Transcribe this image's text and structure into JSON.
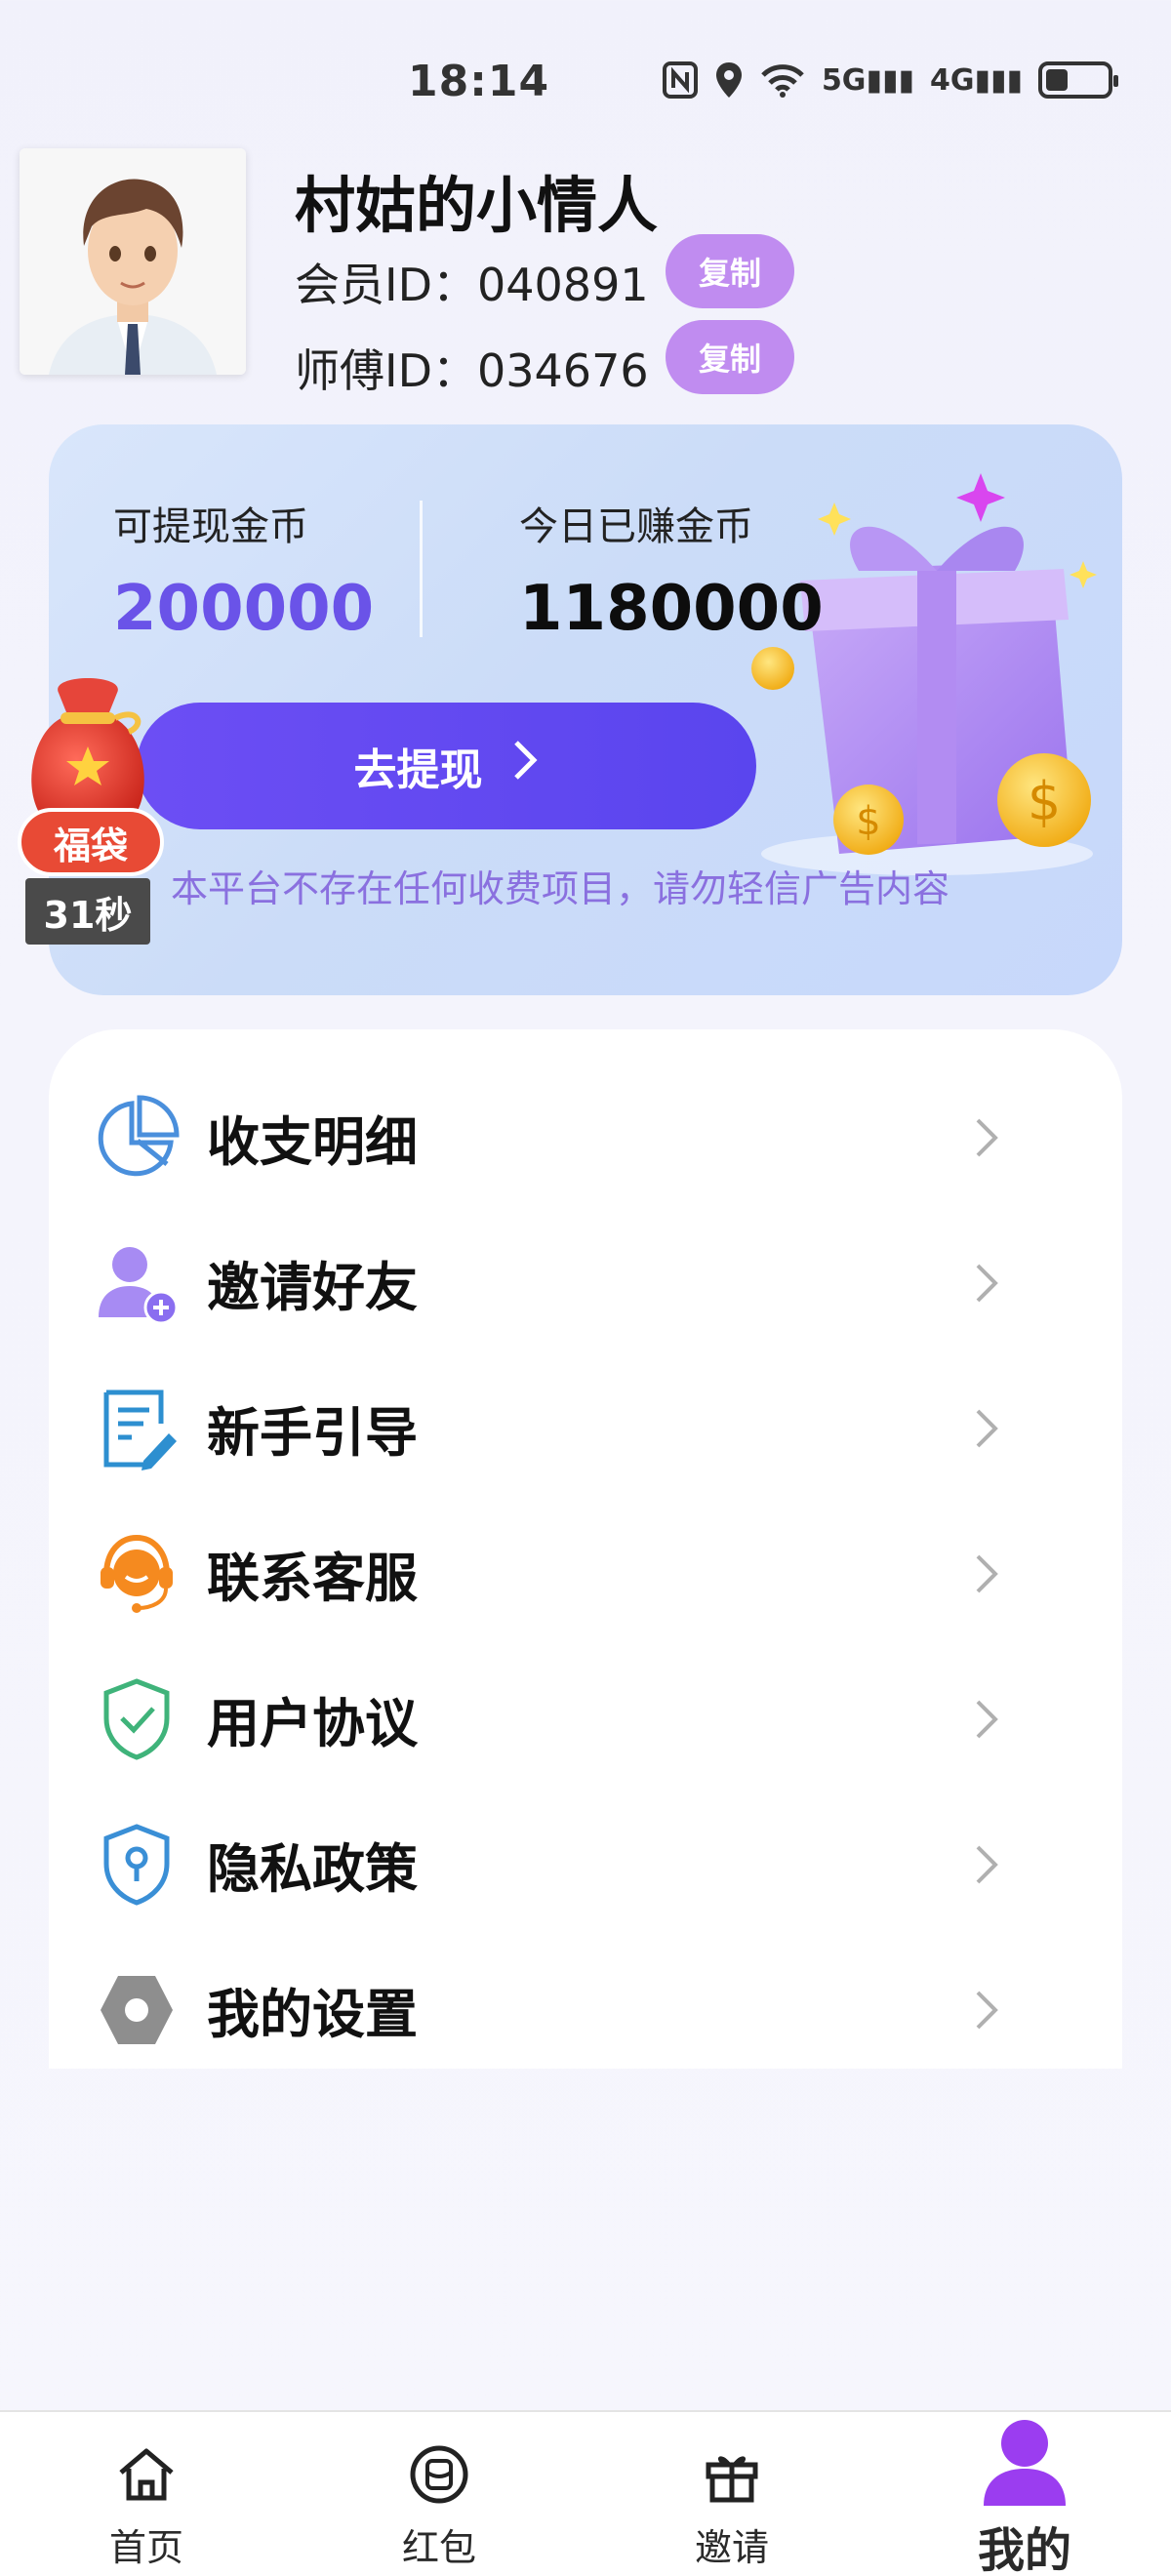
{
  "status_bar": {
    "time": "18:14",
    "icons": [
      "nfc-icon",
      "location-icon",
      "wifi-icon",
      "signal-5g-icon",
      "signal-4g-icon",
      "battery-icon"
    ],
    "net1": "5G",
    "net2": "4G"
  },
  "profile": {
    "nickname": "村姑的小情人",
    "member_id_label": "会员ID：",
    "member_id": "040891",
    "master_id_label": "师傅ID：",
    "master_id": "034676",
    "copy_label": "复制"
  },
  "wallet": {
    "withdrawable_label": "可提现金币",
    "withdrawable_value": "200000",
    "today_label": "今日已赚金币",
    "today_value": "1180000",
    "withdraw_button": "去提现",
    "notice": "本平台不存在任何收费项目，请勿轻信广告内容"
  },
  "lucky_bag": {
    "label": "福袋",
    "timer": "31秒"
  },
  "menu": [
    {
      "label": "收支明细",
      "icon": "pie-chart-icon"
    },
    {
      "label": "邀请好友",
      "icon": "add-user-icon"
    },
    {
      "label": "新手引导",
      "icon": "document-edit-icon"
    },
    {
      "label": "联系客服",
      "icon": "customer-service-icon"
    },
    {
      "label": "用户协议",
      "icon": "shield-check-icon"
    },
    {
      "label": "隐私政策",
      "icon": "privacy-shield-icon"
    },
    {
      "label": "我的设置",
      "icon": "settings-hexagon-icon"
    }
  ],
  "nav": [
    {
      "label": "首页",
      "icon": "home-icon"
    },
    {
      "label": "红包",
      "icon": "red-packet-icon"
    },
    {
      "label": "邀请",
      "icon": "gift-icon"
    },
    {
      "label": "我的",
      "icon": "user-icon",
      "active": true
    }
  ],
  "colors": {
    "accent": "#5a45ee",
    "copy_button": "#c08cf0",
    "withdrawable_value": "#6a53e8",
    "notice": "#8a70df",
    "active_nav_icon": "#9b3df0"
  }
}
